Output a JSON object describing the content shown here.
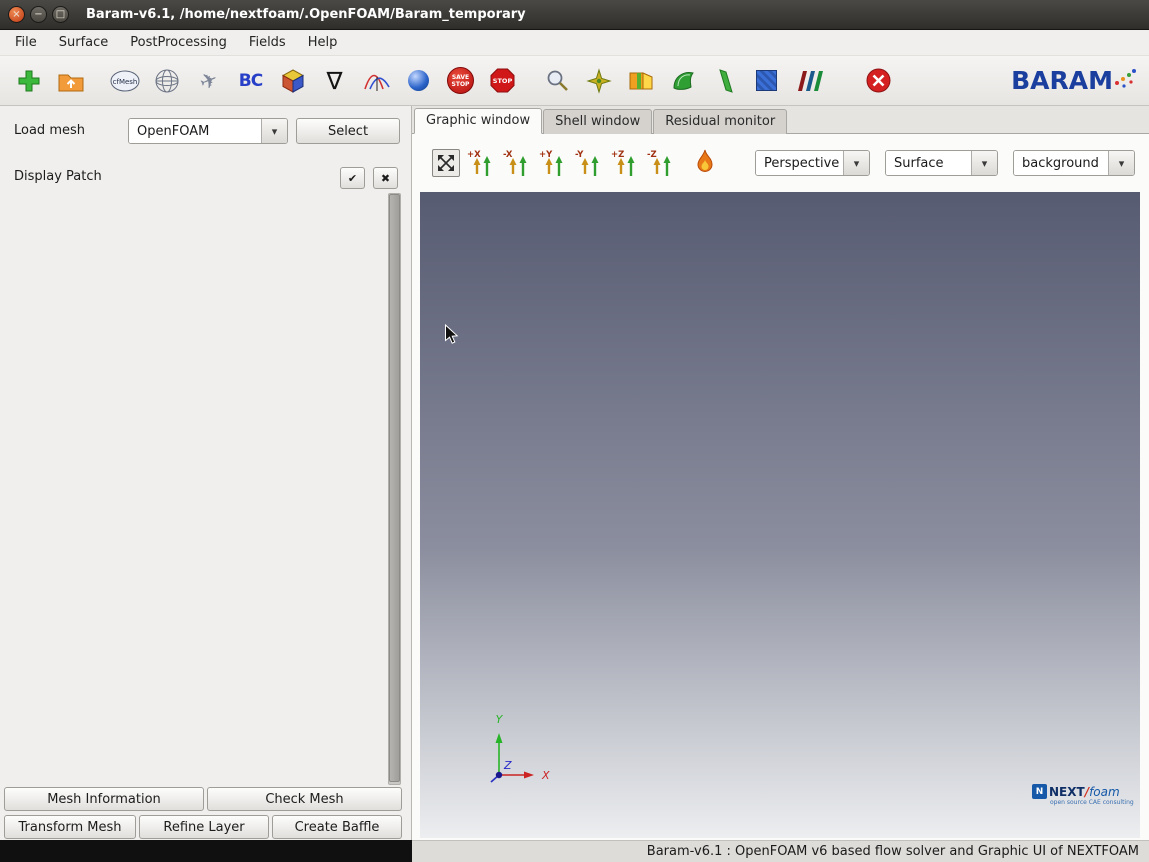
{
  "window": {
    "title": "Baram-v6.1, /home/nextfoam/.OpenFOAM/Baram_temporary",
    "buttons": {
      "close": "×",
      "minimize": "−",
      "maximize": "□"
    }
  },
  "menu": {
    "items": [
      "File",
      "Surface",
      "PostProcessing",
      "Fields",
      "Help"
    ]
  },
  "toolbar": {
    "cfmesh_label": "cfMesh",
    "jet_glyph": "✈",
    "bc_label": "BC",
    "nabla": "∇",
    "save_stop": {
      "line1": "SAVE",
      "line2": "STOP"
    },
    "stop_label": "STOP",
    "brand": "BARAM",
    "brand_color": "#1b3f9e"
  },
  "left_panel": {
    "load_mesh_label": "Load mesh",
    "mesh_format": "OpenFOAM",
    "select_button": "Select",
    "display_patch_label": "Display Patch",
    "check_all_glyph": "✔",
    "uncheck_all_glyph": "✖",
    "mesh_information_button": "Mesh Information",
    "check_mesh_button": "Check Mesh",
    "transform_mesh_button": "Transform Mesh",
    "refine_layer_button": "Refine Layer",
    "create_baffle_button": "Create Baffle"
  },
  "tabs": {
    "graphic": "Graphic window",
    "shell": "Shell window",
    "residual": "Residual monitor"
  },
  "viewport": {
    "axis_buttons": [
      "+X",
      "-X",
      "+Y",
      "-Y",
      "+Z",
      "-Z"
    ],
    "projection": "Perspective",
    "render_mode": "Surface",
    "background_mode": "background",
    "dropdown_glyph": "▾",
    "triad": {
      "x": "X",
      "y": "Y",
      "z": "Z"
    },
    "colors": {
      "bg_top": "#575b72",
      "bg_bottom": "#eceef0"
    }
  },
  "logo": {
    "mark": "N",
    "next": "NEXT",
    "slash": "/",
    "foam": "foam",
    "tagline": "open source CAE consulting"
  },
  "statusbar": {
    "text": "Baram-v6.1 : OpenFOAM v6 based flow solver and Graphic UI of NEXTFOAM"
  }
}
